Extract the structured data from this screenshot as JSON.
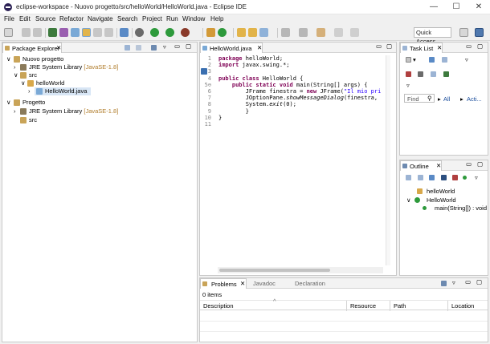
{
  "window": {
    "title": "eclipse-workspace - Nuovo progetto/src/helloWorld/HelloWorld.java - Eclipse IDE",
    "minimize": "—",
    "maximize": "☐",
    "close": "✕"
  },
  "menu": [
    "File",
    "Edit",
    "Source",
    "Refactor",
    "Navigate",
    "Search",
    "Project",
    "Run",
    "Window",
    "Help"
  ],
  "toolbar": {
    "quick_access": "Quick Access"
  },
  "package_explorer": {
    "tab_label": "Package Explorer",
    "tree": [
      {
        "label": "Nuovo progetto",
        "extra": ""
      },
      {
        "label": "JRE System Library",
        "extra": "[JavaSE-1.8]"
      },
      {
        "label": "src",
        "extra": ""
      },
      {
        "label": "helloWorld",
        "extra": ""
      },
      {
        "label": "HelloWorld.java",
        "extra": ""
      },
      {
        "label": "Progetto",
        "extra": ""
      },
      {
        "label": "JRE System Library",
        "extra": "[JavaSE-1.8]"
      },
      {
        "label": "src",
        "extra": ""
      }
    ]
  },
  "editor": {
    "tab_label": "HelloWorld.java",
    "lines": [
      {
        "num": "1",
        "parts": [
          [
            "kw",
            "package"
          ],
          [
            "",
            " helloWorld;"
          ]
        ]
      },
      {
        "num": "2",
        "parts": [
          [
            "kw",
            "import"
          ],
          [
            "",
            " javax.swing.*;"
          ]
        ]
      },
      {
        "num": "3",
        "parts": []
      },
      {
        "num": "4",
        "parts": [
          [
            "kw",
            "public class"
          ],
          [
            "",
            " HelloWorld {"
          ]
        ]
      },
      {
        "num": "5⊖",
        "parts": [
          [
            "",
            "    "
          ],
          [
            "kw",
            "public static void"
          ],
          [
            "",
            " main(String[] args) {"
          ]
        ]
      },
      {
        "num": "6",
        "parts": [
          [
            "",
            "        JFrame finestra = "
          ],
          [
            "kw",
            "new"
          ],
          [
            "",
            " JFrame("
          ],
          [
            "str",
            "\"Il mio pri"
          ]
        ]
      },
      {
        "num": "7",
        "parts": [
          [
            "",
            "        JOptionPane."
          ],
          [
            "it",
            "showMessageDialog"
          ],
          [
            "",
            "(finestra,"
          ]
        ]
      },
      {
        "num": "8",
        "parts": [
          [
            "",
            "        System."
          ],
          [
            "it",
            "exit"
          ],
          [
            "",
            "(0);"
          ]
        ]
      },
      {
        "num": "9",
        "parts": [
          [
            "",
            "        }"
          ]
        ]
      },
      {
        "num": "10",
        "parts": [
          [
            "",
            "}"
          ]
        ]
      },
      {
        "num": "11",
        "parts": []
      }
    ]
  },
  "task_list": {
    "tab_label": "Task List",
    "find_placeholder": "Find",
    "all_label": "All",
    "activate_label": "Acti..."
  },
  "outline": {
    "tab_label": "Outline",
    "items": [
      {
        "label": "helloWorld"
      },
      {
        "label": "HelloWorld"
      },
      {
        "label": "main(String[]) : void"
      }
    ]
  },
  "bottom": {
    "tabs": [
      "Problems",
      "Javadoc",
      "Declaration"
    ],
    "status": "0 items",
    "columns": [
      "Description",
      "Resource",
      "Path",
      "Location"
    ]
  },
  "colors": {
    "keyword": "#7f0055",
    "string": "#2a00ff",
    "library": "#b07c2a",
    "selection": "#d8e6f5"
  }
}
